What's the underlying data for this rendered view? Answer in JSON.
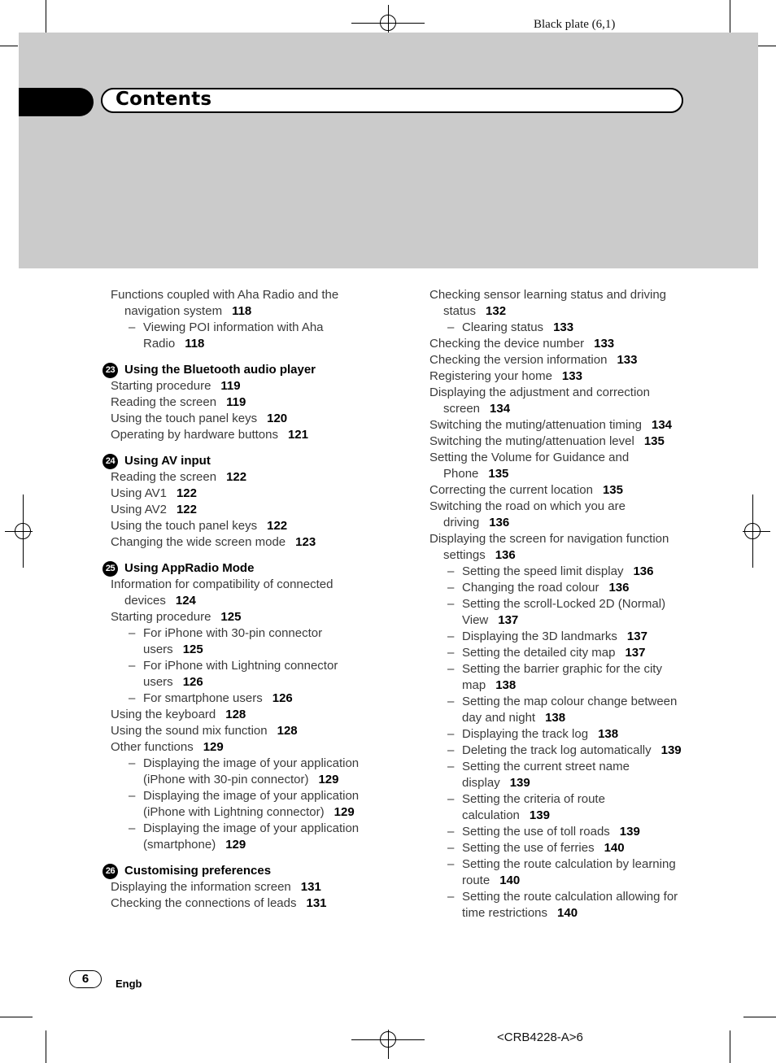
{
  "plate_label": "Black plate (6,1)",
  "header": {
    "title": "Contents"
  },
  "footer": {
    "page_number": "6",
    "language": "Engb",
    "doc_code": "<CRB4228-A>6"
  },
  "left_column": {
    "intro": [
      {
        "text": "Functions coupled with Aha Radio and the navigation system",
        "page": "118",
        "level": 0
      },
      {
        "text": "Viewing POI information with Aha Radio",
        "page": "118",
        "level": 1
      }
    ],
    "sections": [
      {
        "number": "23",
        "title": "Using the Bluetooth audio player",
        "items": [
          {
            "text": "Starting procedure",
            "page": "119",
            "level": 0
          },
          {
            "text": "Reading the screen",
            "page": "119",
            "level": 0
          },
          {
            "text": "Using the touch panel keys",
            "page": "120",
            "level": 0
          },
          {
            "text": "Operating by hardware buttons",
            "page": "121",
            "level": 0
          }
        ]
      },
      {
        "number": "24",
        "title": "Using AV input",
        "items": [
          {
            "text": "Reading the screen",
            "page": "122",
            "level": 0
          },
          {
            "text": "Using AV1",
            "page": "122",
            "level": 0
          },
          {
            "text": "Using AV2",
            "page": "122",
            "level": 0
          },
          {
            "text": "Using the touch panel keys",
            "page": "122",
            "level": 0
          },
          {
            "text": "Changing the wide screen mode",
            "page": "123",
            "level": 0
          }
        ]
      },
      {
        "number": "25",
        "title": "Using AppRadio Mode",
        "items": [
          {
            "text": "Information for compatibility of connected devices",
            "page": "124",
            "level": 0
          },
          {
            "text": "Starting procedure",
            "page": "125",
            "level": 0
          },
          {
            "text": "For iPhone with 30-pin connector users",
            "page": "125",
            "level": 1
          },
          {
            "text": "For iPhone with Lightning connector users",
            "page": "126",
            "level": 1
          },
          {
            "text": "For smartphone users",
            "page": "126",
            "level": 1
          },
          {
            "text": "Using the keyboard",
            "page": "128",
            "level": 0
          },
          {
            "text": "Using the sound mix function",
            "page": "128",
            "level": 0
          },
          {
            "text": "Other functions",
            "page": "129",
            "level": 0
          },
          {
            "text": "Displaying the image of your application (iPhone with 30-pin connector)",
            "page": "129",
            "level": 1
          },
          {
            "text": "Displaying the image of your application (iPhone with Lightning connector)",
            "page": "129",
            "level": 1
          },
          {
            "text": "Displaying the image of your application (smartphone)",
            "page": "129",
            "level": 1
          }
        ]
      },
      {
        "number": "26",
        "title": "Customising preferences",
        "items": [
          {
            "text": "Displaying the information screen",
            "page": "131",
            "level": 0
          },
          {
            "text": "Checking the connections of leads",
            "page": "131",
            "level": 0
          }
        ]
      }
    ]
  },
  "right_column": {
    "items": [
      {
        "text": "Checking sensor learning status and driving status",
        "page": "132",
        "level": 0
      },
      {
        "text": "Clearing status",
        "page": "133",
        "level": 1
      },
      {
        "text": "Checking the device number",
        "page": "133",
        "level": 0
      },
      {
        "text": "Checking the version information",
        "page": "133",
        "level": 0
      },
      {
        "text": "Registering your home",
        "page": "133",
        "level": 0
      },
      {
        "text": "Displaying the adjustment and correction screen",
        "page": "134",
        "level": 0
      },
      {
        "text": "Switching the muting/attenuation timing",
        "page": "134",
        "level": 0
      },
      {
        "text": "Switching the muting/attenuation level",
        "page": "135",
        "level": 0
      },
      {
        "text": "Setting the Volume for Guidance and Phone",
        "page": "135",
        "level": 0
      },
      {
        "text": "Correcting the current location",
        "page": "135",
        "level": 0
      },
      {
        "text": "Switching the road on which you are driving",
        "page": "136",
        "level": 0
      },
      {
        "text": "Displaying the screen for navigation function settings",
        "page": "136",
        "level": 0
      },
      {
        "text": "Setting the speed limit display",
        "page": "136",
        "level": 1
      },
      {
        "text": "Changing the road colour",
        "page": "136",
        "level": 1
      },
      {
        "text": "Setting the scroll-Locked 2D (Normal) View",
        "page": "137",
        "level": 1
      },
      {
        "text": "Displaying the 3D landmarks",
        "page": "137",
        "level": 1
      },
      {
        "text": "Setting the detailed city map",
        "page": "137",
        "level": 1
      },
      {
        "text": "Setting the barrier graphic for the city map",
        "page": "138",
        "level": 1
      },
      {
        "text": "Setting the map colour change between day and night",
        "page": "138",
        "level": 1
      },
      {
        "text": "Displaying the track log",
        "page": "138",
        "level": 1
      },
      {
        "text": "Deleting the track log automatically",
        "page": "139",
        "level": 1
      },
      {
        "text": "Setting the current street name display",
        "page": "139",
        "level": 1
      },
      {
        "text": "Setting the criteria of route calculation",
        "page": "139",
        "level": 1
      },
      {
        "text": "Setting the use of toll roads",
        "page": "139",
        "level": 1
      },
      {
        "text": "Setting the use of ferries",
        "page": "140",
        "level": 1
      },
      {
        "text": "Setting the route calculation by learning route",
        "page": "140",
        "level": 1
      },
      {
        "text": "Setting the route calculation allowing for time restrictions",
        "page": "140",
        "level": 1
      }
    ]
  },
  "dash_glyph": "–"
}
